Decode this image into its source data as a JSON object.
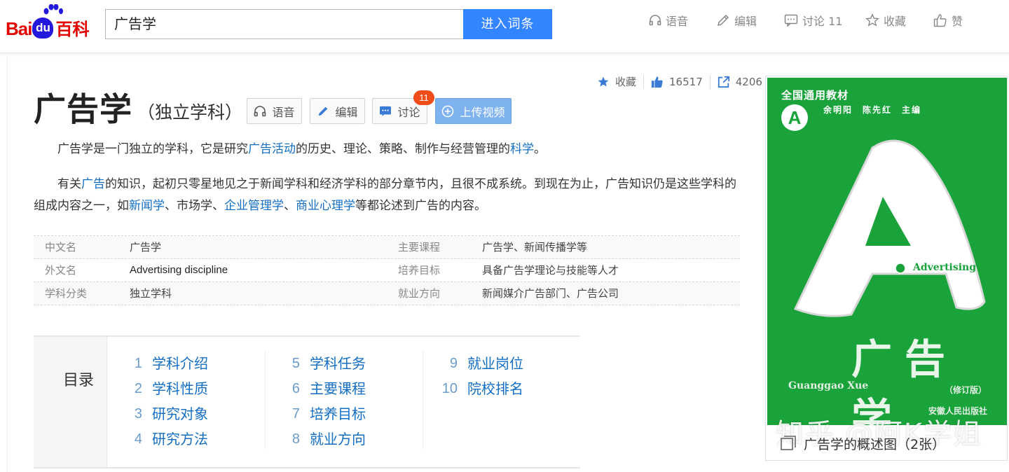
{
  "header": {
    "logo_bai": "Bai",
    "logo_du": "du",
    "logo_baike": "百科",
    "search_value": "广告学",
    "search_button": "进入词条",
    "tools": [
      {
        "icon": "headphones-icon",
        "label": "语音"
      },
      {
        "icon": "pencil-icon",
        "label": "编辑"
      },
      {
        "icon": "chat-icon",
        "label": "讨论 11"
      },
      {
        "icon": "star-icon",
        "label": "收藏"
      },
      {
        "icon": "thumbs-up-icon",
        "label": "赞"
      }
    ]
  },
  "stats": {
    "favorite_label": "收藏",
    "likes": "16517",
    "shares": "4206"
  },
  "title": {
    "main": "广告学",
    "sub": "（独立学科）"
  },
  "title_buttons": {
    "voice": "语音",
    "edit": "编辑",
    "discuss": "讨论",
    "discuss_badge": "11",
    "upload_video": "上传视频"
  },
  "summary": {
    "p1_a": "广告学是一门独立的学科，它是研究",
    "p1_link1": "广告活动",
    "p1_b": "的历史、理论、策略、制作与经营管理的",
    "p1_link2": "科学",
    "p1_c": "。",
    "p2_a": "有关",
    "p2_link1": "广告",
    "p2_b": "的知识，起初只零星地见之于新闻学科和经济学科的部分章节内，且很不成系统。到现在为止，广告知识仍是这些学科的组成内容之一，如",
    "p2_link2": "新闻学",
    "p2_c": "、市场学、",
    "p2_link3": "企业管理学",
    "p2_d": "、",
    "p2_link4": "商业心理学",
    "p2_e": "等都论述到广告的内容。"
  },
  "basic_info": [
    {
      "k1": "中文名",
      "v1": "广告学",
      "k2": "主要课程",
      "v2": "广告学、新闻传播学等"
    },
    {
      "k1": "外文名",
      "v1": "Advertising discipline",
      "k2": "培养目标",
      "v2": "具备广告学理论与技能等人才"
    },
    {
      "k1": "学科分类",
      "v1": "独立学科",
      "k2": "就业方向",
      "v2": "新闻媒介广告部门、广告公司"
    }
  ],
  "catalog": {
    "title": "目录",
    "col1": [
      {
        "num": "1",
        "text": "学科介绍"
      },
      {
        "num": "2",
        "text": "学科性质"
      },
      {
        "num": "3",
        "text": "研究对象"
      },
      {
        "num": "4",
        "text": "研究方法"
      }
    ],
    "col2": [
      {
        "num": "5",
        "text": "学科任务"
      },
      {
        "num": "6",
        "text": "主要课程"
      },
      {
        "num": "7",
        "text": "培养目标"
      },
      {
        "num": "8",
        "text": "就业方向"
      }
    ],
    "col3": [
      {
        "num": "9",
        "text": "就业岗位"
      },
      {
        "num": "10",
        "text": "院校排名"
      }
    ]
  },
  "picture": {
    "book_top": "全国通用教材",
    "book_authors": "余明阳　陈先红　主编",
    "book_letter": "A",
    "book_advertising": "Advertising",
    "book_advertising_small": "Advertising",
    "book_title": "广告学",
    "book_pinyin": "Guanggao  Xue",
    "book_revised": "（修订版）",
    "book_publisher": "安徽人民出版社",
    "watermark": "知乎 @阿K学姐",
    "caption": "广告学的概述图（2张）"
  },
  "colors": {
    "accent": "#3385ff",
    "link": "#136ec2",
    "badge": "#f04c1a",
    "book_green": "#19a33a"
  }
}
